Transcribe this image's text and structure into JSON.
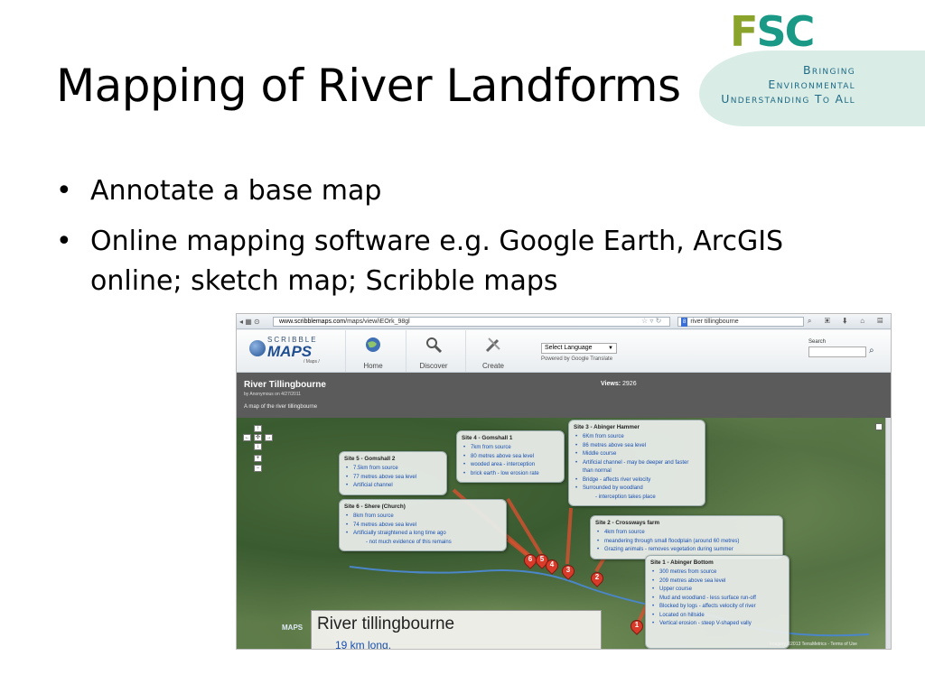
{
  "slide": {
    "title": "Mapping of River Landforms",
    "bullets": [
      "Annotate a base map",
      "Online mapping software e.g. Google Earth, ArcGIS online; sketch map; Scribble maps"
    ],
    "logo": {
      "letters": "FSC",
      "tagline": [
        "Bringing",
        "Environmental",
        "Understanding To All"
      ]
    }
  },
  "browser": {
    "url_host": "www.scribblemaps.com",
    "url_path": "/maps/view/iEOrk_98gl",
    "search_text": "river tillingbourne",
    "zoom_badge": "08"
  },
  "site": {
    "brand_top": "SCRIBBLE",
    "brand_main": "MAPS",
    "brand_sub": "/ Maps /",
    "nav": [
      {
        "label": "Home",
        "icon": "globe-icon"
      },
      {
        "label": "Discover",
        "icon": "magnifier-icon"
      },
      {
        "label": "Create",
        "icon": "tools-icon"
      }
    ],
    "language_select": "Select Language",
    "powered_by": "Powered by Google Translate",
    "search_label": "Search"
  },
  "map_info": {
    "title": "River Tillingbourne",
    "byline": "by Anonymous on 4/27/2011",
    "description": "A map of the river tillingbourne",
    "views_label": "Views:",
    "views_value": "2926"
  },
  "callouts": [
    {
      "title": "Site 5 - Gomshall 2",
      "items": [
        "7.5km from source",
        "77 metres above sea level",
        "Artificial channel"
      ]
    },
    {
      "title": "Site 4 - Gomshall 1",
      "items": [
        "7km from source",
        "80 metres above sea level",
        "wooded area - interception",
        "brick earth - low erosion rate"
      ]
    },
    {
      "title": "Site 3 - Abinger Hammer",
      "items": [
        "6Km from source",
        "86 metres above sea level",
        "Middle course",
        "Artificial channel - may be deeper and faster than normal",
        "Bridge - affects river velocity",
        "Surrounded by woodland",
        "- interception takes place"
      ]
    },
    {
      "title": "Site 6 - Shere (Church)",
      "items": [
        "8km from source",
        "74 metres above sea level",
        "Artificially straightened a long time ago",
        "- not much evidence of this remains"
      ]
    },
    {
      "title": "Site 2 - Crossways farm",
      "items": [
        "4km from source",
        "meandering through small floodplain (around 60 metres)",
        "Grazing animals - removes vegetation during summer"
      ]
    },
    {
      "title": "Site 1 - Abinger Bottom",
      "items": [
        "300 metres from source",
        "209 metres above sea level",
        "Upper course",
        "Mud and woodland - less surface run-off",
        "Blocked by logs - affects velocity of river",
        "Located on hillside",
        "Vertical erosion - steep V-shaped vally"
      ]
    }
  ],
  "pins": [
    "6",
    "5",
    "4",
    "3",
    "2",
    "1"
  ],
  "legend": {
    "title": "River tillingbourne",
    "subtitle": "19 km long."
  },
  "attribution": "Imagery ©2013 TerraMetrics - Terms of Use",
  "bottom_brand": "MAPS"
}
